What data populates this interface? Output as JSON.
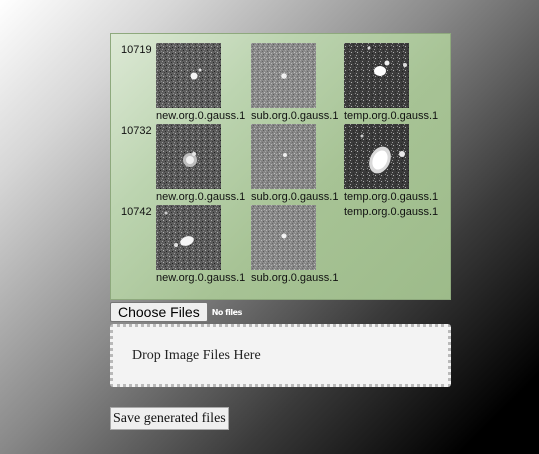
{
  "gallery": {
    "rows": [
      {
        "id": "10719",
        "items": [
          {
            "caption": "new.org.0.gauss.1",
            "kind": "new"
          },
          {
            "caption": "sub.org.0.gauss.1",
            "kind": "sub"
          },
          {
            "caption": "temp.org.0.gauss.1",
            "kind": "temp"
          }
        ]
      },
      {
        "id": "10732",
        "items": [
          {
            "caption": "new.org.0.gauss.1",
            "kind": "new"
          },
          {
            "caption": "sub.org.0.gauss.1",
            "kind": "sub"
          },
          {
            "caption": "temp.org.0.gauss.1",
            "kind": "temp"
          }
        ]
      },
      {
        "id": "10742",
        "items": [
          {
            "caption": "new.org.0.gauss.1",
            "kind": "new"
          },
          {
            "caption": "sub.org.0.gauss.1",
            "kind": "sub"
          }
        ],
        "extra_caption": "temp.org.0.gauss.1"
      }
    ]
  },
  "file_input": {
    "button_label": "Choose Files",
    "status_text": "No files"
  },
  "dropzone": {
    "label": "Drop Image Files Here"
  },
  "save_button": {
    "label": "Save generated files"
  },
  "colors": {
    "panel": "#a7c395",
    "dropzone_bg": "#f3f3f3"
  }
}
